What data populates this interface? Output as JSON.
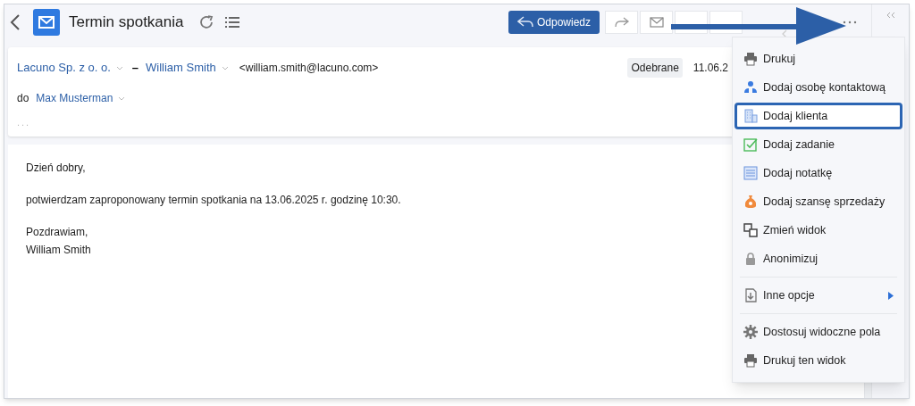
{
  "header": {
    "title": "Termin spotkania",
    "reply_button": "Odpowiedz"
  },
  "message": {
    "sender_company": "Lacuno Sp. z o. o.",
    "separator": "–",
    "sender_name": "William Smith",
    "sender_email": "<william.smith@lacuno.com>",
    "folder": "Odebrane",
    "date": "11.06.2",
    "to_label": "do",
    "recipient": "Max Musterman",
    "more": "..."
  },
  "body": [
    "Dzień dobry,",
    "potwierdzam zaproponowany termin spotkania na 13.06.2025 r. godzinę 10:30.",
    "Pozdrawiam,\nWilliam Smith"
  ],
  "menu": {
    "sections": [
      [
        {
          "label": "Drukuj",
          "kind": "print",
          "selected": false,
          "submenu": false
        },
        {
          "label": "Dodaj osobę kontaktową",
          "kind": "contact",
          "selected": false,
          "submenu": false
        },
        {
          "label": "Dodaj klienta",
          "kind": "client",
          "selected": true,
          "submenu": false
        },
        {
          "label": "Dodaj zadanie",
          "kind": "task",
          "selected": false,
          "submenu": false
        },
        {
          "label": "Dodaj notatkę",
          "kind": "note",
          "selected": false,
          "submenu": false
        },
        {
          "label": "Dodaj szansę sprzedaży",
          "kind": "money",
          "selected": false,
          "submenu": false
        },
        {
          "label": "Zmień widok",
          "kind": "view",
          "selected": false,
          "submenu": false
        },
        {
          "label": "Anonimizuj",
          "kind": "lock",
          "selected": false,
          "submenu": false
        }
      ],
      [
        {
          "label": "Inne opcje",
          "kind": "download",
          "selected": false,
          "submenu": true
        }
      ],
      [
        {
          "label": "Dostosuj widoczne pola",
          "kind": "gear",
          "selected": false,
          "submenu": false
        },
        {
          "label": "Drukuj ten widok",
          "kind": "print",
          "selected": false,
          "submenu": false
        }
      ]
    ]
  }
}
